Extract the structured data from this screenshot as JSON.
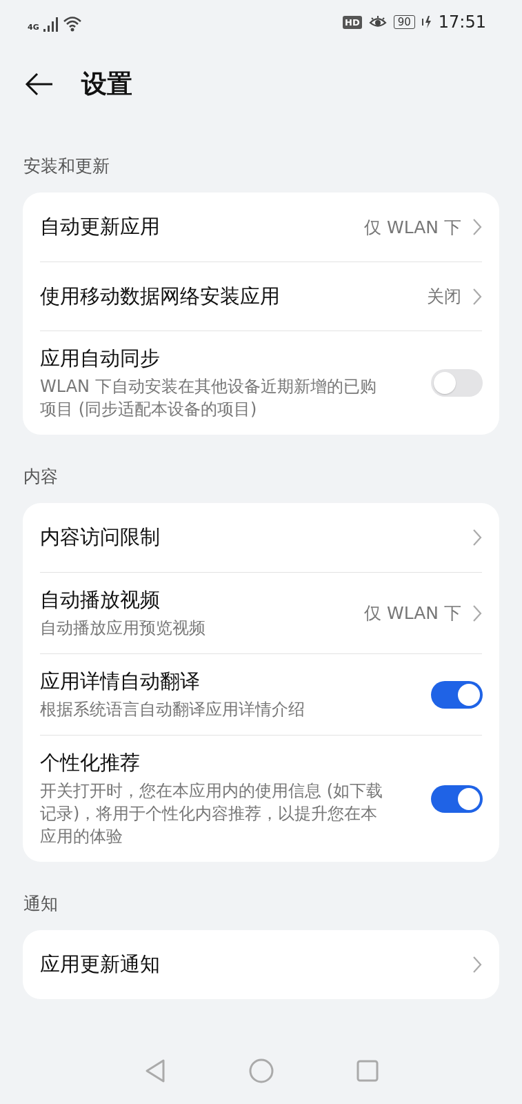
{
  "status_bar": {
    "network": "4G",
    "hd_badge": "HD",
    "battery": "90",
    "time": "17:51"
  },
  "header": {
    "title": "设置"
  },
  "sections": [
    {
      "title": "安装和更新",
      "items": [
        {
          "kind": "link",
          "title": "自动更新应用",
          "value": "仅 WLAN 下"
        },
        {
          "kind": "link",
          "title": "使用移动数据网络安装应用",
          "value": "关闭"
        },
        {
          "kind": "switch",
          "title": "应用自动同步",
          "subtitle": "WLAN 下自动安装在其他设备近期新增的已购项目 (同步适配本设备的项目)",
          "on": false
        }
      ]
    },
    {
      "title": "内容",
      "items": [
        {
          "kind": "link",
          "title": "内容访问限制"
        },
        {
          "kind": "link",
          "title": "自动播放视频",
          "subtitle": "自动播放应用预览视频",
          "value": "仅 WLAN 下"
        },
        {
          "kind": "switch",
          "title": "应用详情自动翻译",
          "subtitle": "根据系统语言自动翻译应用详情介绍",
          "on": true
        },
        {
          "kind": "switch",
          "title": "个性化推荐",
          "subtitle": "开关打开时，您在本应用内的使用信息 (如下载记录)，将用于个性化内容推荐，以提升您在本应用的体验",
          "on": true
        }
      ]
    },
    {
      "title": "通知",
      "items": [
        {
          "kind": "link",
          "title": "应用更新通知"
        }
      ]
    }
  ]
}
